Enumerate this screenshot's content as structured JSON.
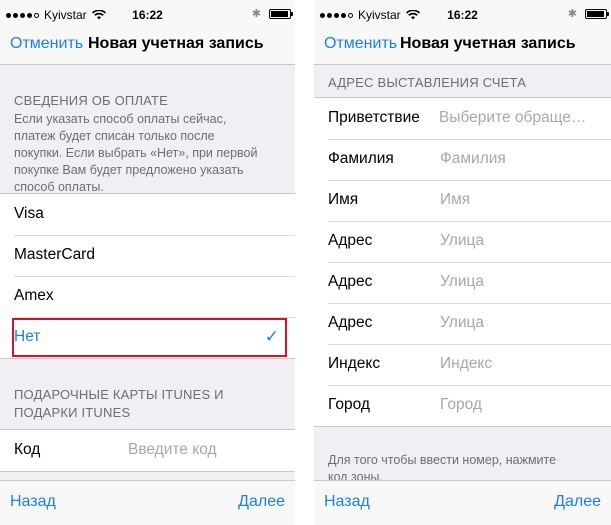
{
  "left_screen": {
    "status": {
      "carrier": "Kyivstar",
      "time": "16:22"
    },
    "nav": {
      "cancel": "Отменить",
      "title": "Новая учетная запись"
    },
    "payment_header": "СВЕДЕНИЯ ОБ ОПЛАТЕ",
    "payment_footer_lines": [
      "Если указать способ оплаты сейчас,",
      "платеж будет списан только после",
      "покупки. Если выбрать «Нет», при первой",
      "покупке Вам будет предложено указать",
      "способ оплаты."
    ],
    "payment_options": [
      {
        "label": "Visa"
      },
      {
        "label": "MasterCard"
      },
      {
        "label": "Amex"
      },
      {
        "label": "Нет",
        "selected": true
      }
    ],
    "gift_header_lines": [
      "ПОДАРОЧНЫЕ КАРТЫ ITUNES И",
      "ПОДАРКИ ITUNES"
    ],
    "code_row": {
      "label": "Код",
      "placeholder": "Введите код"
    },
    "toolbar": {
      "back": "Назад",
      "next": "Далее"
    }
  },
  "right_screen": {
    "status": {
      "carrier": "Kyivstar",
      "time": "16:22"
    },
    "nav": {
      "cancel": "Отменить",
      "title": "Новая учетная запись"
    },
    "billing_header": "АДРЕС ВЫСТАВЛЕНИЯ СЧЕТА",
    "fields": [
      {
        "label": "Приветствие",
        "placeholder": "Выберите обраще…"
      },
      {
        "label": "Фамилия",
        "placeholder": "Фамилия"
      },
      {
        "label": "Имя",
        "placeholder": "Имя"
      },
      {
        "label": "Адрес",
        "placeholder": "Улица"
      },
      {
        "label": "Адрес",
        "placeholder": "Улица"
      },
      {
        "label": "Адрес",
        "placeholder": "Улица"
      },
      {
        "label": "Индекс",
        "placeholder": "Индекс"
      },
      {
        "label": "Город",
        "placeholder": "Город"
      }
    ],
    "footer_lines": [
      "Для того чтобы ввести номер, нажмите",
      "код зоны."
    ],
    "toolbar": {
      "back": "Назад",
      "next": "Далее"
    }
  },
  "colors": {
    "accent": "#1a7ff0",
    "highlight": "#d3152a",
    "background": "#efeff4"
  },
  "icons": [
    "wifi-icon",
    "bluetooth-icon",
    "battery-icon",
    "signal-dots-icon",
    "checkmark-icon"
  ]
}
